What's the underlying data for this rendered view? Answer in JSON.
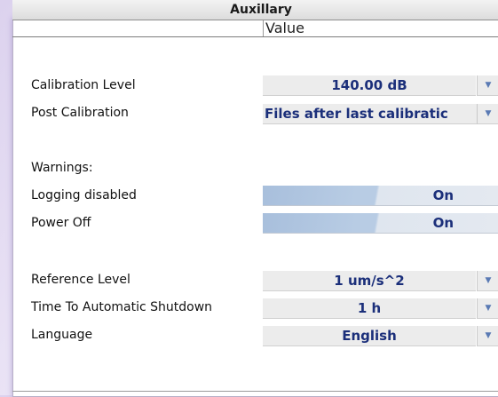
{
  "window": {
    "title": "Auxillary"
  },
  "table": {
    "value_header": "Value"
  },
  "rows": {
    "calibration_level": {
      "label": "Calibration Level",
      "value": "140.00 dB"
    },
    "post_calibration": {
      "label": "Post Calibration",
      "value": "Files after last calibratic"
    },
    "warnings_heading": "Warnings:",
    "logging_disabled": {
      "label": "Logging disabled",
      "value": "On"
    },
    "power_off": {
      "label": "Power Off",
      "value": "On"
    },
    "reference_level": {
      "label": "Reference Level",
      "value": "1 um/s^2"
    },
    "time_to_shutdown": {
      "label": "Time To Automatic Shutdown",
      "value": "1 h"
    },
    "language": {
      "label": "Language",
      "value": "English"
    }
  },
  "icons": {
    "dropdown_arrow": "chevron-down-icon"
  }
}
